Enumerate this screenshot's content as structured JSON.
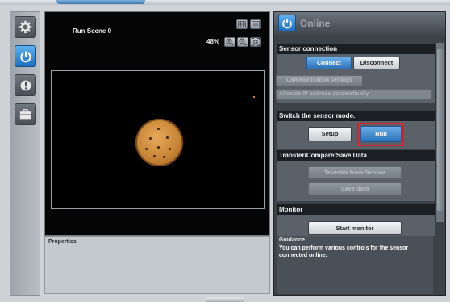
{
  "viewer": {
    "scene_label": "Run Scene 0",
    "zoom_percent": "48%"
  },
  "properties": {
    "title": "Properties"
  },
  "panel": {
    "title": "Online",
    "sensor_connection": {
      "heading": "Sensor connection",
      "connect_label": "Connect",
      "disconnect_label": "Disconnect",
      "communication_settings_label": "Communication settings",
      "allocate_ip_label": "Allocate IP address automatically"
    },
    "sensor_mode": {
      "heading": "Switch the sensor mode.",
      "setup_label": "Setup",
      "run_label": "Run"
    },
    "transfer": {
      "heading": "Transfer/Compare/Save Data",
      "transfer_label": "Transfer from Sensor",
      "save_label": "Save data"
    },
    "monitor": {
      "heading": "Monitor",
      "start_label": "Start monitor"
    },
    "guidance": {
      "title": "Guidance",
      "text": "You can perform various controls for the sensor connected online."
    }
  },
  "icons": {
    "left_toolbar": [
      "gear-icon",
      "power-icon",
      "alert-icon",
      "toolbox-icon"
    ],
    "viewer_toolbar": [
      "grid-icon",
      "layout-icon",
      "zoom-in-icon",
      "zoom-out-icon",
      "fit-icon"
    ]
  },
  "colors": {
    "accent_blue": "#2d72b8",
    "highlight_red": "#e01e25"
  }
}
